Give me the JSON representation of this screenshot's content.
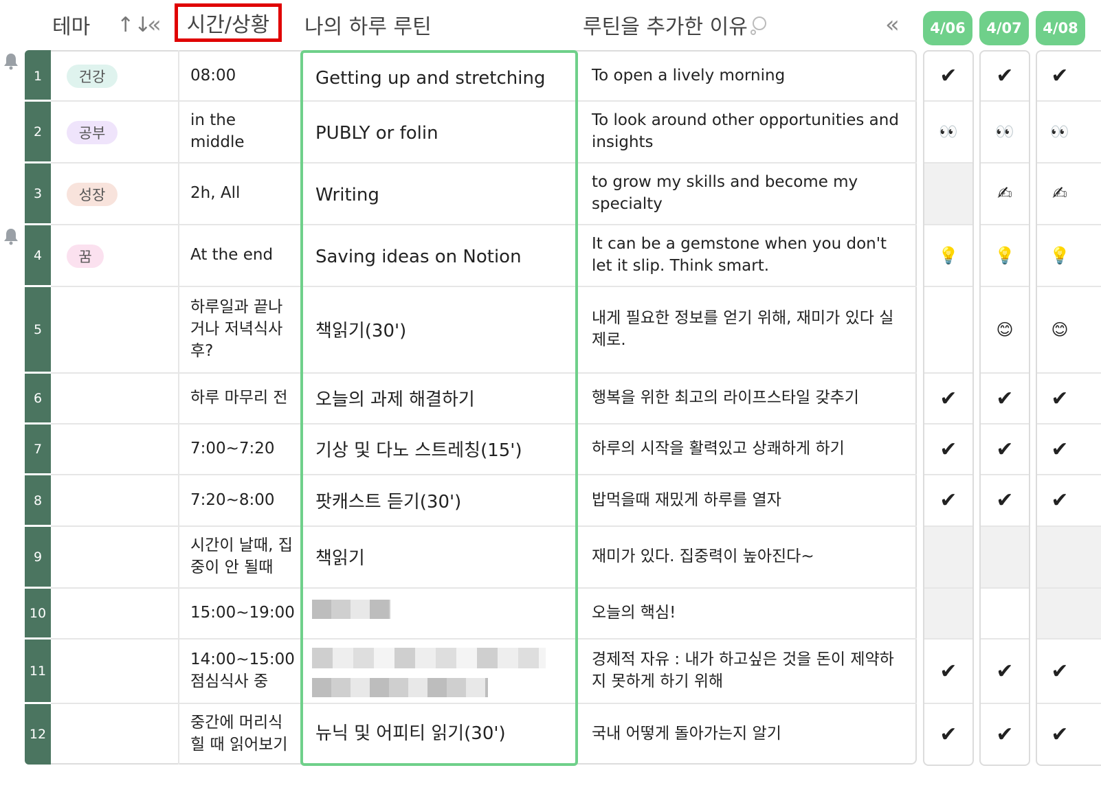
{
  "header": {
    "theme": "테마",
    "sort_icon": "↑↓",
    "collapse_icon": "«",
    "time": "시간/상황",
    "routine": "나의 하루 루틴",
    "reason": "루틴을 추가한 이유",
    "dates": [
      "4/06",
      "4/07",
      "4/08"
    ]
  },
  "colors": {
    "accent_green": "#6fd08a",
    "row_number_bg": "#4b7560",
    "highlight_red": "#e00000"
  },
  "rows": [
    {
      "num": "1",
      "tag": "건강",
      "tag_color": "#dff3ee",
      "time": "08:00",
      "routine": "Getting up and stretching",
      "reason": "To open a lively morning",
      "marks": [
        "✔",
        "✔",
        "✔"
      ]
    },
    {
      "num": "2",
      "tag": "공부",
      "tag_color": "#efe4fb",
      "time": "in the middle",
      "routine": "PUBLY or folin",
      "reason": "To look around other opportunities and insights",
      "marks": [
        "👀",
        "👀",
        "👀"
      ]
    },
    {
      "num": "3",
      "tag": "성장",
      "tag_color": "#f8e3dc",
      "time": "2h, All",
      "routine": "Writing",
      "reason": "to grow my skills and become my specialty",
      "marks": [
        "",
        "✍",
        "✍"
      ]
    },
    {
      "num": "4",
      "tag": "꿈",
      "tag_color": "#fbe1ef",
      "time": "At the end",
      "routine": "Saving ideas on Notion",
      "reason": "It can be a gemstone when you don't let it slip. Think smart.",
      "marks": [
        "💡",
        "💡",
        "💡"
      ]
    },
    {
      "num": "5",
      "tag": "",
      "tag_color": "",
      "time": "하루일과 끝나거나 저녁식사 후?",
      "routine": "책읽기(30')",
      "reason": "내게 필요한 정보를 얻기 위해, 재미가 있다 실제로.",
      "marks": [
        "",
        "😊",
        "😊"
      ]
    },
    {
      "num": "6",
      "tag": "",
      "tag_color": "",
      "time": "하루 마무리 전",
      "routine": "오늘의 과제 해결하기",
      "reason": "행복을 위한 최고의 라이프스타일 갖추기",
      "marks": [
        "✔",
        "✔",
        "✔"
      ]
    },
    {
      "num": "7",
      "tag": "",
      "tag_color": "",
      "time": "7:00~7:20",
      "routine": "기상 및 다노 스트레칭(15')",
      "reason": "하루의 시작을 활력있고 상쾌하게 하기",
      "marks": [
        "✔",
        "✔",
        "✔"
      ]
    },
    {
      "num": "8",
      "tag": "",
      "tag_color": "",
      "time": "7:20~8:00",
      "routine": "팟캐스트 듣기(30')",
      "reason": "밥먹을때 재밌게 하루를 열자",
      "marks": [
        "✔",
        "✔",
        "✔"
      ]
    },
    {
      "num": "9",
      "tag": "",
      "tag_color": "",
      "time": "시간이 날때, 집중이 안 될때",
      "routine": "책읽기",
      "reason": "재미가 있다. 집중력이 높아진다~",
      "marks": [
        "",
        "",
        ""
      ]
    },
    {
      "num": "10",
      "tag": "",
      "tag_color": "",
      "time": "15:00~19:00",
      "routine": "",
      "reason": "오늘의 핵심!",
      "marks": [
        "",
        "",
        ""
      ]
    },
    {
      "num": "11",
      "tag": "",
      "tag_color": "",
      "time": "14:00~15:00 점심식사 중",
      "routine": "",
      "reason": "경제적 자유 : 내가 하고싶은 것을 돈이 제약하지 못하게 하기 위해",
      "marks": [
        "✔",
        "✔",
        "✔"
      ]
    },
    {
      "num": "12",
      "tag": "",
      "tag_color": "",
      "time": "중간에 머리식힐 때 읽어보기",
      "routine": "뉴닉 및 어피티 읽기(30')",
      "reason": "국내 어떻게 돌아가는지 알기",
      "marks": [
        "✔",
        "✔",
        "✔"
      ]
    }
  ]
}
